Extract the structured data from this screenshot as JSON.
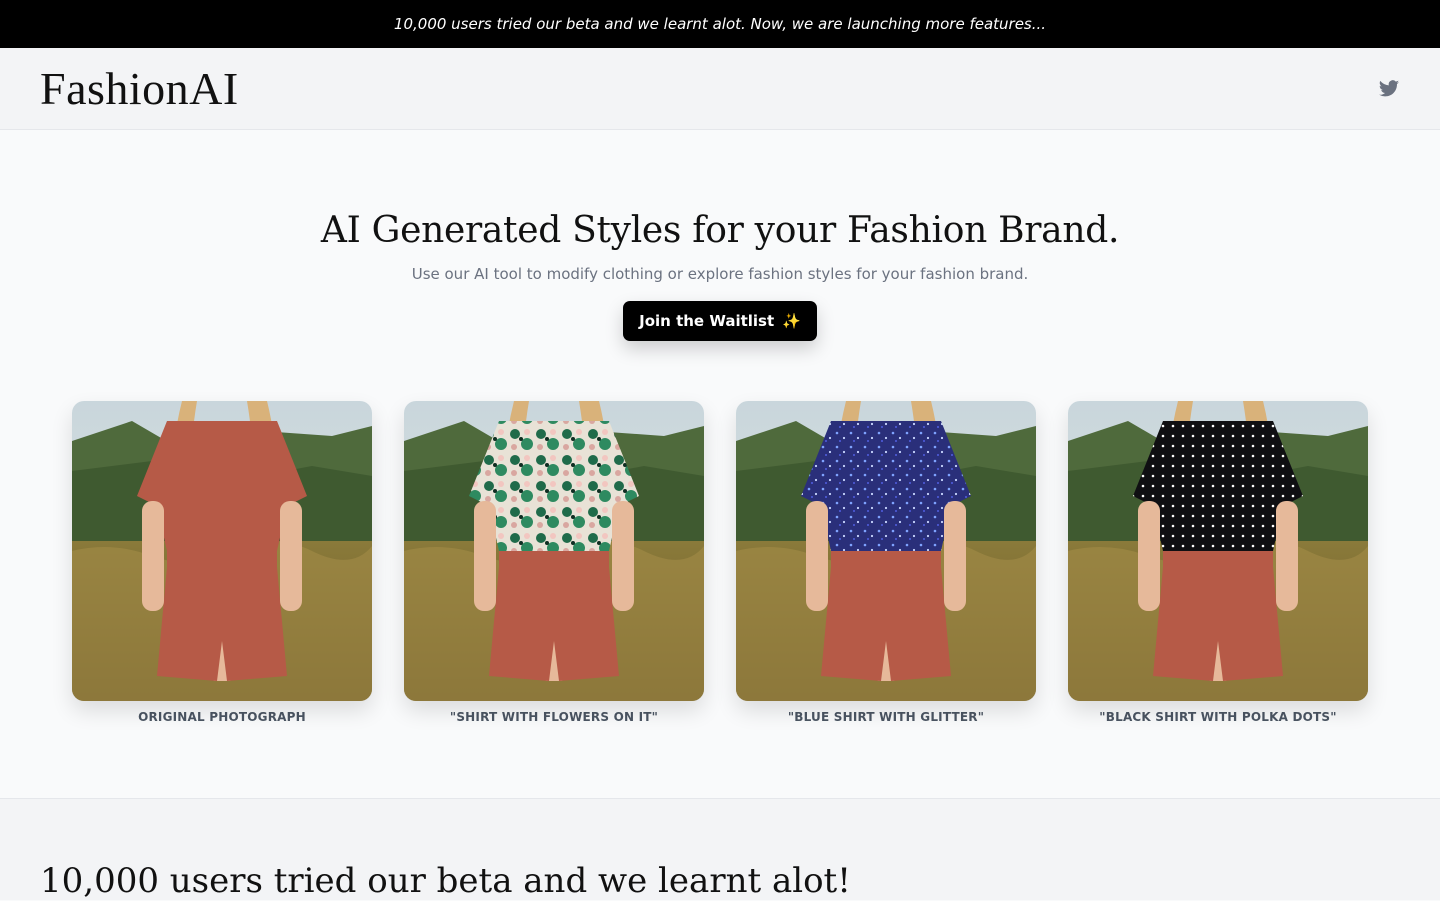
{
  "announcement": "10,000 users tried our beta and we learnt alot. Now, we are launching more features...",
  "header": {
    "logo": "FashionAI",
    "social_icon": "twitter-icon"
  },
  "hero": {
    "title": "AI Generated Styles for your Fashion Brand.",
    "subtitle": "Use our AI tool to modify clothing or explore fashion styles for your fashion brand.",
    "cta_label": "Join the Waitlist",
    "cta_emoji": "✨"
  },
  "gallery": [
    {
      "caption": "Original Photograph",
      "shirt": "plain",
      "shirt_color": "#b65a47"
    },
    {
      "caption": "\"Shirt with flowers on it\"",
      "shirt": "floral",
      "shirt_color": "#1f4d3a"
    },
    {
      "caption": "\"Blue shirt with glitter\"",
      "shirt": "glitter",
      "shirt_color": "#2a2f7a"
    },
    {
      "caption": "\"Black shirt with polka dots\"",
      "shirt": "polka",
      "shirt_color": "#111111"
    }
  ],
  "section": {
    "title": "10,000 users tried our beta and we learnt alot!"
  },
  "colors": {
    "accent": "#000000",
    "shorts": "#b65a47",
    "subtitle": "#6b7280",
    "caption": "#4b5563"
  }
}
